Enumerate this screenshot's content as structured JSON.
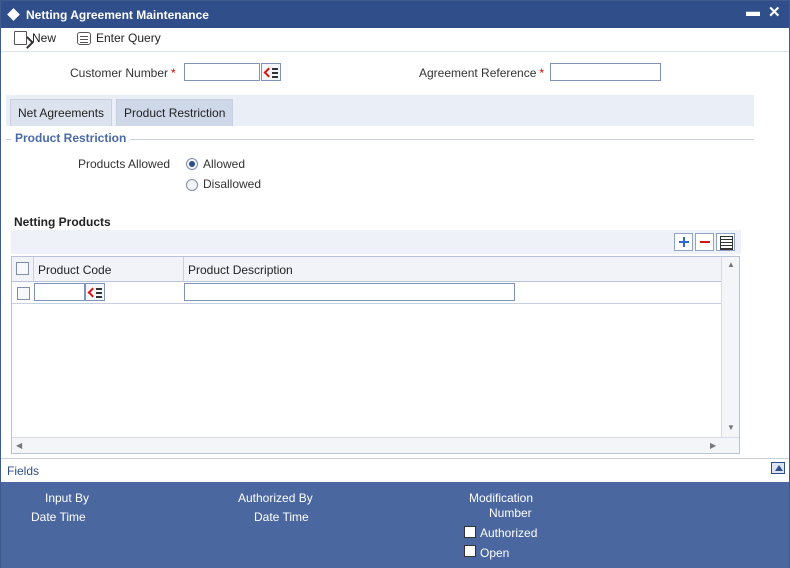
{
  "window": {
    "title": "Netting Agreement Maintenance",
    "minimize_icon": "minimize-icon",
    "close_icon": "close-icon"
  },
  "toolbar": {
    "new_label": "New",
    "enter_query_label": "Enter Query"
  },
  "header_fields": {
    "customer_number_label": "Customer Number",
    "customer_number_value": "",
    "agreement_reference_label": "Agreement Reference",
    "agreement_reference_value": "",
    "required_marker": "*"
  },
  "tabs": [
    {
      "label": "Net Agreements",
      "active": false
    },
    {
      "label": "Product Restriction",
      "active": true
    }
  ],
  "product_restriction": {
    "section_title": "Product Restriction",
    "products_allowed_label": "Products Allowed",
    "options": [
      {
        "label": "Allowed",
        "selected": true
      },
      {
        "label": "Disallowed",
        "selected": false
      }
    ]
  },
  "netting_products": {
    "title": "Netting Products",
    "columns": [
      "Product Code",
      "Product Description"
    ],
    "rows": [
      {
        "checked": false,
        "product_code": "",
        "product_description": ""
      }
    ]
  },
  "fields_bar": {
    "label": "Fields"
  },
  "footer": {
    "input_by_label": "Input By",
    "date_time_label_1": "Date Time",
    "authorized_by_label": "Authorized By",
    "date_time_label_2": "Date Time",
    "modification_label": "Modification",
    "number_label": "Number",
    "authorized_checkbox_label": "Authorized",
    "open_checkbox_label": "Open",
    "authorized_checked": false,
    "open_checked": false
  },
  "colors": {
    "title_bar": "#2f4e8a",
    "footer": "#4a67a0",
    "section_title": "#4a6aa5",
    "required": "#cc0000"
  }
}
